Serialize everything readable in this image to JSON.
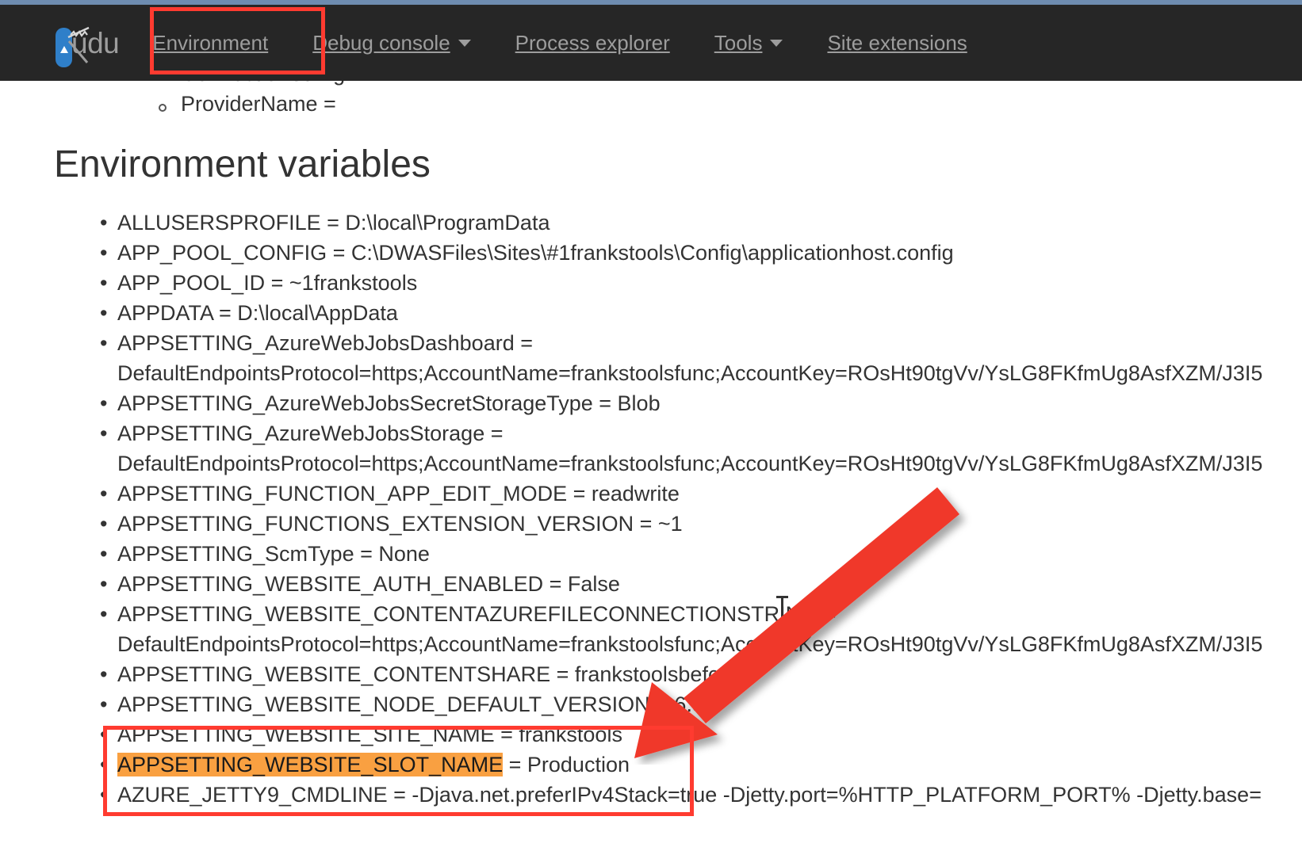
{
  "theme": {
    "navbar_bg": "#262626",
    "top_strip": "#6e8cb0",
    "nav_text": "#9d9d9d",
    "annotation_red": "#ff3b30",
    "highlight_orange": "#f9a041",
    "body_text": "#333333",
    "logo_blue": "#2f7fc9"
  },
  "navbar": {
    "brand": "udu",
    "brand_full": "Kudu",
    "items": [
      {
        "label": "Environment",
        "has_caret": false,
        "active": true
      },
      {
        "label": "Debug console",
        "has_caret": true,
        "active": false
      },
      {
        "label": "Process explorer",
        "has_caret": false,
        "active": false
      },
      {
        "label": "Tools",
        "has_caret": true,
        "active": false
      },
      {
        "label": "Site extensions",
        "has_caret": false,
        "active": false
      }
    ]
  },
  "previous_section": {
    "clipped_item": "ConnectionString",
    "visible_item": "ProviderName ="
  },
  "main": {
    "heading": "Environment variables",
    "variables": [
      {
        "text": "ALLUSERSPROFILE = D:\\local\\ProgramData"
      },
      {
        "text": "APP_POOL_CONFIG = C:\\DWASFiles\\Sites\\#1frankstools\\Config\\applicationhost.config"
      },
      {
        "text": "APP_POOL_ID = ~1frankstools"
      },
      {
        "text": "APPDATA = D:\\local\\AppData"
      },
      {
        "text": "APPSETTING_AzureWebJobsDashboard =",
        "continuation": "DefaultEndpointsProtocol=https;AccountName=frankstoolsfunc;AccountKey=ROsHt90tgVv/YsLG8FKfmUg8AsfXZM/J3I5"
      },
      {
        "text": "APPSETTING_AzureWebJobsSecretStorageType = Blob"
      },
      {
        "text": "APPSETTING_AzureWebJobsStorage =",
        "continuation": "DefaultEndpointsProtocol=https;AccountName=frankstoolsfunc;AccountKey=ROsHt90tgVv/YsLG8FKfmUg8AsfXZM/J3I5"
      },
      {
        "text": "APPSETTING_FUNCTION_APP_EDIT_MODE = readwrite"
      },
      {
        "text": "APPSETTING_FUNCTIONS_EXTENSION_VERSION = ~1"
      },
      {
        "text": "APPSETTING_ScmType = None"
      },
      {
        "text": "APPSETTING_WEBSITE_AUTH_ENABLED = False"
      },
      {
        "text": "APPSETTING_WEBSITE_CONTENTAZUREFILECONNECTIONSTRING =",
        "continuation": "DefaultEndpointsProtocol=https;AccountName=frankstoolsfunc;AccountKey=ROsHt90tgVv/YsLG8FKfmUg8AsfXZM/J3I5"
      },
      {
        "text": "APPSETTING_WEBSITE_CONTENTSHARE = frankstoolsbefc"
      },
      {
        "text": "APPSETTING_WEBSITE_NODE_DEFAULT_VERSION = 6.5.0"
      },
      {
        "text": "APPSETTING_WEBSITE_SITE_NAME = frankstools"
      },
      {
        "highlighted": "APPSETTING_WEBSITE_SLOT_NAME",
        "text": " = Production"
      },
      {
        "text": "AZURE_JETTY9_CMDLINE = -Djava.net.preferIPv4Stack=true -Djetty.port=%HTTP_PLATFORM_PORT% -Djetty.base="
      }
    ]
  },
  "annotations": {
    "nav_box_target": "Environment",
    "bottom_box_targets": "APPSETTING_WEBSITE_SITE_NAME and APPSETTING_WEBSITE_SLOT_NAME",
    "arrow_points_to": "APPSETTING_WEBSITE_SLOT_NAME"
  }
}
